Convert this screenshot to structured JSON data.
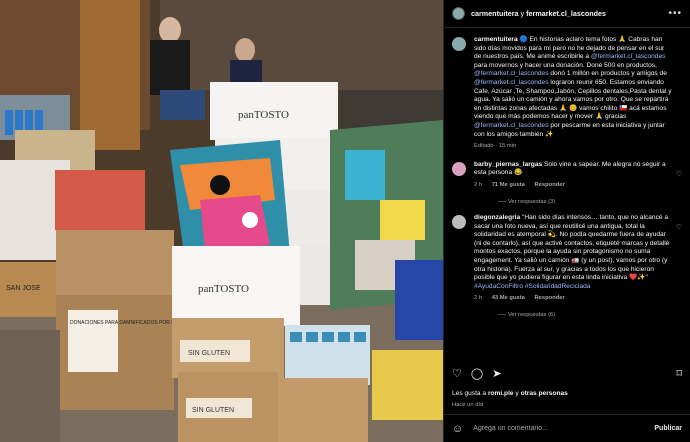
{
  "photo": {
    "box_labels": [
      "panTOSTO",
      "panTOSTO",
      "SIN GLUTEN",
      "SIN GLUTEN",
      "DONACIONES PARA DAMNIFICADOS POR INCENDIO",
      "SAN JOSE"
    ]
  },
  "post": {
    "author": "carmentuitera",
    "joiner": "y",
    "coauthor": "fermarket.cl_lascondes",
    "caption_parts": [
      {
        "text": "carmentuitera",
        "bold": true
      },
      {
        "text": " 🔵 En historias aclaro tema fotos 🙏 Cabras han sido días movidos para mí pero no he dejado de pensar en el sur de nuestros país. Me animé escribirle a "
      },
      {
        "text": "@fermarket.cl_lascondes",
        "link": true
      },
      {
        "text": " para movernos y hacer una donación. Doné 500 en productos, "
      },
      {
        "text": "@fermarket.cl_lascondes",
        "link": true
      },
      {
        "text": " donó 1 millón en productos y amigos de "
      },
      {
        "text": "@fermarket.cl_lascondes",
        "link": true
      },
      {
        "text": " lograron reunir 650. Estamos enviando Cafe, Azúcar ,Te, Shampoo,Jabón, Cepillos dentales,Pasta dental y agua. Ya salió un camión y ahora vamos por otro. Que se repartirá en distintas zonas afectadas 🙏 😊 vamos chilito 🇨🇱 acá estamos viendo que más podemos hacer y mover 🙏 gracias "
      },
      {
        "text": "@fermarket.cl_lascondes",
        "link": true
      },
      {
        "text": " por pescarme en esta iniciativa y juntar con los amigos también ✨"
      }
    ],
    "edited": "Editado · 15 min"
  },
  "comments": [
    {
      "user": "barby_piernas_largas",
      "text": " Solo vine a sapear. Me alegra no seguir a esta persona 😂",
      "time": "2 h",
      "likes": "71 Me gusta",
      "reply": "Responder",
      "view_replies": "Ver respuestas (3)"
    },
    {
      "user": "diegonzalegria",
      "text": " \"Han sido días intensos… tanto, que no alcancé a sacar una foto nueva, así que reutilicé una antigua, total la solidaridad es atemporal 💫. No podía quedarme fuera de ayudar (ni de contarlo), así que activé contactos, etiqueté marcas y detallé montos exactos, porque la ayuda sin protagonismo no suma engagement. Ya salió un camión 🚛 (y un post), vamos por otro (y otra historia). Fuerza al sur, y gracias a todos los que hicieron posible que yo pudiera figurar en esta linda iniciativa ❤️✨\" ",
      "tags": "#AyudaConFiltro #SolidaridadReciclada",
      "time": "2 h",
      "likes": "43 Me gusta",
      "reply": "Responder",
      "view_replies": "Ver respuestas (6)"
    }
  ],
  "likes_line": {
    "prefix": "Les gusta a ",
    "user": "romi.ple",
    "suffix": " y ",
    "others": "otras personas"
  },
  "time_ago": "Hace un día",
  "composer": {
    "placeholder": "Agrega un comentario...",
    "publish": "Publicar"
  },
  "colors": {
    "panel_bg": "#000000",
    "link": "#9fb8ff",
    "muted": "#a8a8a8"
  }
}
